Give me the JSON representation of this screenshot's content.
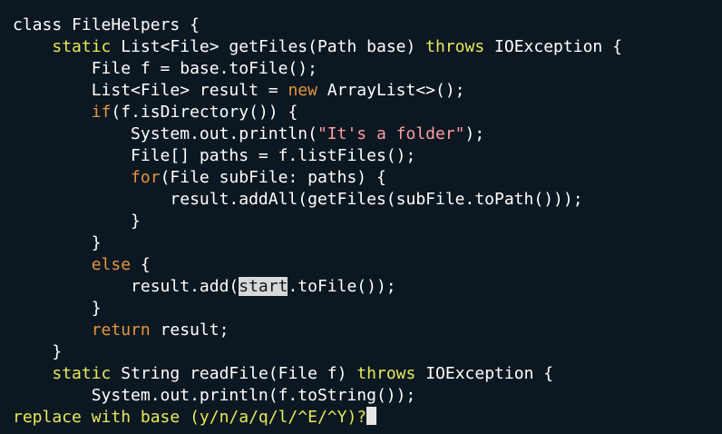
{
  "editor": {
    "lines": [
      [
        {
          "t": "class FileHelpers {"
        }
      ],
      [
        {
          "t": "    "
        },
        {
          "t": "static",
          "c": "kw-yellow"
        },
        {
          "t": " List<File> getFiles(Path base) "
        },
        {
          "t": "throws",
          "c": "kw-yellow"
        },
        {
          "t": " IOException {"
        }
      ],
      [
        {
          "t": "        File f = base.toFile();"
        }
      ],
      [
        {
          "t": "        List<File> result = "
        },
        {
          "t": "new",
          "c": "kw-orange"
        },
        {
          "t": " ArrayList<>();"
        }
      ],
      [
        {
          "t": "        "
        },
        {
          "t": "if",
          "c": "kw-orange"
        },
        {
          "t": "(f.isDirectory()) {"
        }
      ],
      [
        {
          "t": "            System.out.println("
        },
        {
          "t": "\"It's a folder\"",
          "c": "str"
        },
        {
          "t": ");"
        }
      ],
      [
        {
          "t": "            File[] paths = f.listFiles();"
        }
      ],
      [
        {
          "t": "            "
        },
        {
          "t": "for",
          "c": "kw-orange"
        },
        {
          "t": "(File subFile: paths) {"
        }
      ],
      [
        {
          "t": "                result.addAll(getFiles(subFile.toPath()));"
        }
      ],
      [
        {
          "t": "            }"
        }
      ],
      [
        {
          "t": "        }"
        }
      ],
      [
        {
          "t": "        "
        },
        {
          "t": "else",
          "c": "kw-orange"
        },
        {
          "t": " {"
        }
      ],
      [
        {
          "t": "            result.add("
        },
        {
          "t": "start",
          "c": "hl"
        },
        {
          "t": ".toFile());"
        }
      ],
      [
        {
          "t": "        }"
        }
      ],
      [
        {
          "t": "        "
        },
        {
          "t": "return",
          "c": "kw-orange"
        },
        {
          "t": " result;"
        }
      ],
      [
        {
          "t": "    }"
        }
      ],
      [
        {
          "t": "    "
        },
        {
          "t": "static",
          "c": "kw-yellow"
        },
        {
          "t": " String readFile(File f) "
        },
        {
          "t": "throws",
          "c": "kw-yellow"
        },
        {
          "t": " IOException {"
        }
      ],
      [
        {
          "t": "        System.out.println(f.toString());"
        }
      ]
    ]
  },
  "minibuffer": {
    "prompt": "replace with base (y/n/a/q/l/^E/^Y)?"
  },
  "colors": {
    "background": "#0c1821",
    "keyword_yellow": "#e8e85a",
    "keyword_orange": "#e5953e",
    "string": "#ff9aa2",
    "match_highlight": "#d8d8d8"
  }
}
